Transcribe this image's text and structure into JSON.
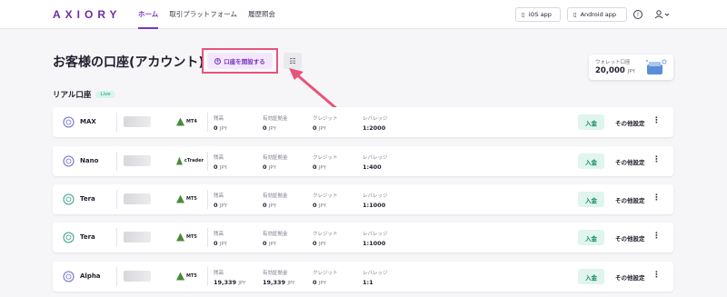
{
  "header": {
    "logo": "AXIORY",
    "nav": [
      {
        "label": "ホーム",
        "active": true
      },
      {
        "label": "取引プラットフォーム",
        "active": false
      },
      {
        "label": "履歴照会",
        "active": false
      }
    ],
    "ios_label": "iOS app",
    "android_label": "Android app"
  },
  "page": {
    "title": "お客様の口座(アカウント)",
    "open_account_label": "口座を開設する"
  },
  "wallet": {
    "label": "ウォレット口座",
    "amount": "20,000",
    "currency": "JPY"
  },
  "section": {
    "title": "リアル口座",
    "badge": "Live"
  },
  "labels": {
    "balance": "残高",
    "margin": "有効証拠金",
    "credit": "クレジット",
    "leverage": "レバレッジ",
    "deposit": "入金",
    "other": "その他設定"
  },
  "accounts": [
    {
      "name": "MAX",
      "platform": "MT4",
      "balance": "0",
      "margin": "0",
      "credit": "0",
      "leverage": "1:2000",
      "currency": "JPY"
    },
    {
      "name": "Nano",
      "platform": "cTrader",
      "balance": "0",
      "margin": "0",
      "credit": "0",
      "leverage": "1:400",
      "currency": "JPY"
    },
    {
      "name": "Tera",
      "platform": "MT5",
      "balance": "0",
      "margin": "0",
      "credit": "0",
      "leverage": "1:1000",
      "currency": "JPY"
    },
    {
      "name": "Tera",
      "platform": "MT5",
      "balance": "0",
      "margin": "0",
      "credit": "0",
      "leverage": "1:1000",
      "currency": "JPY"
    },
    {
      "name": "Alpha",
      "platform": "MT5",
      "balance": "19,339",
      "margin": "19,339",
      "credit": "0",
      "leverage": "1:1",
      "currency": "JPY"
    }
  ],
  "colors": {
    "brand": "#7b35c0",
    "highlight": "#e8537a",
    "deposit_bg": "#dff5ee",
    "deposit_text": "#16876a"
  }
}
